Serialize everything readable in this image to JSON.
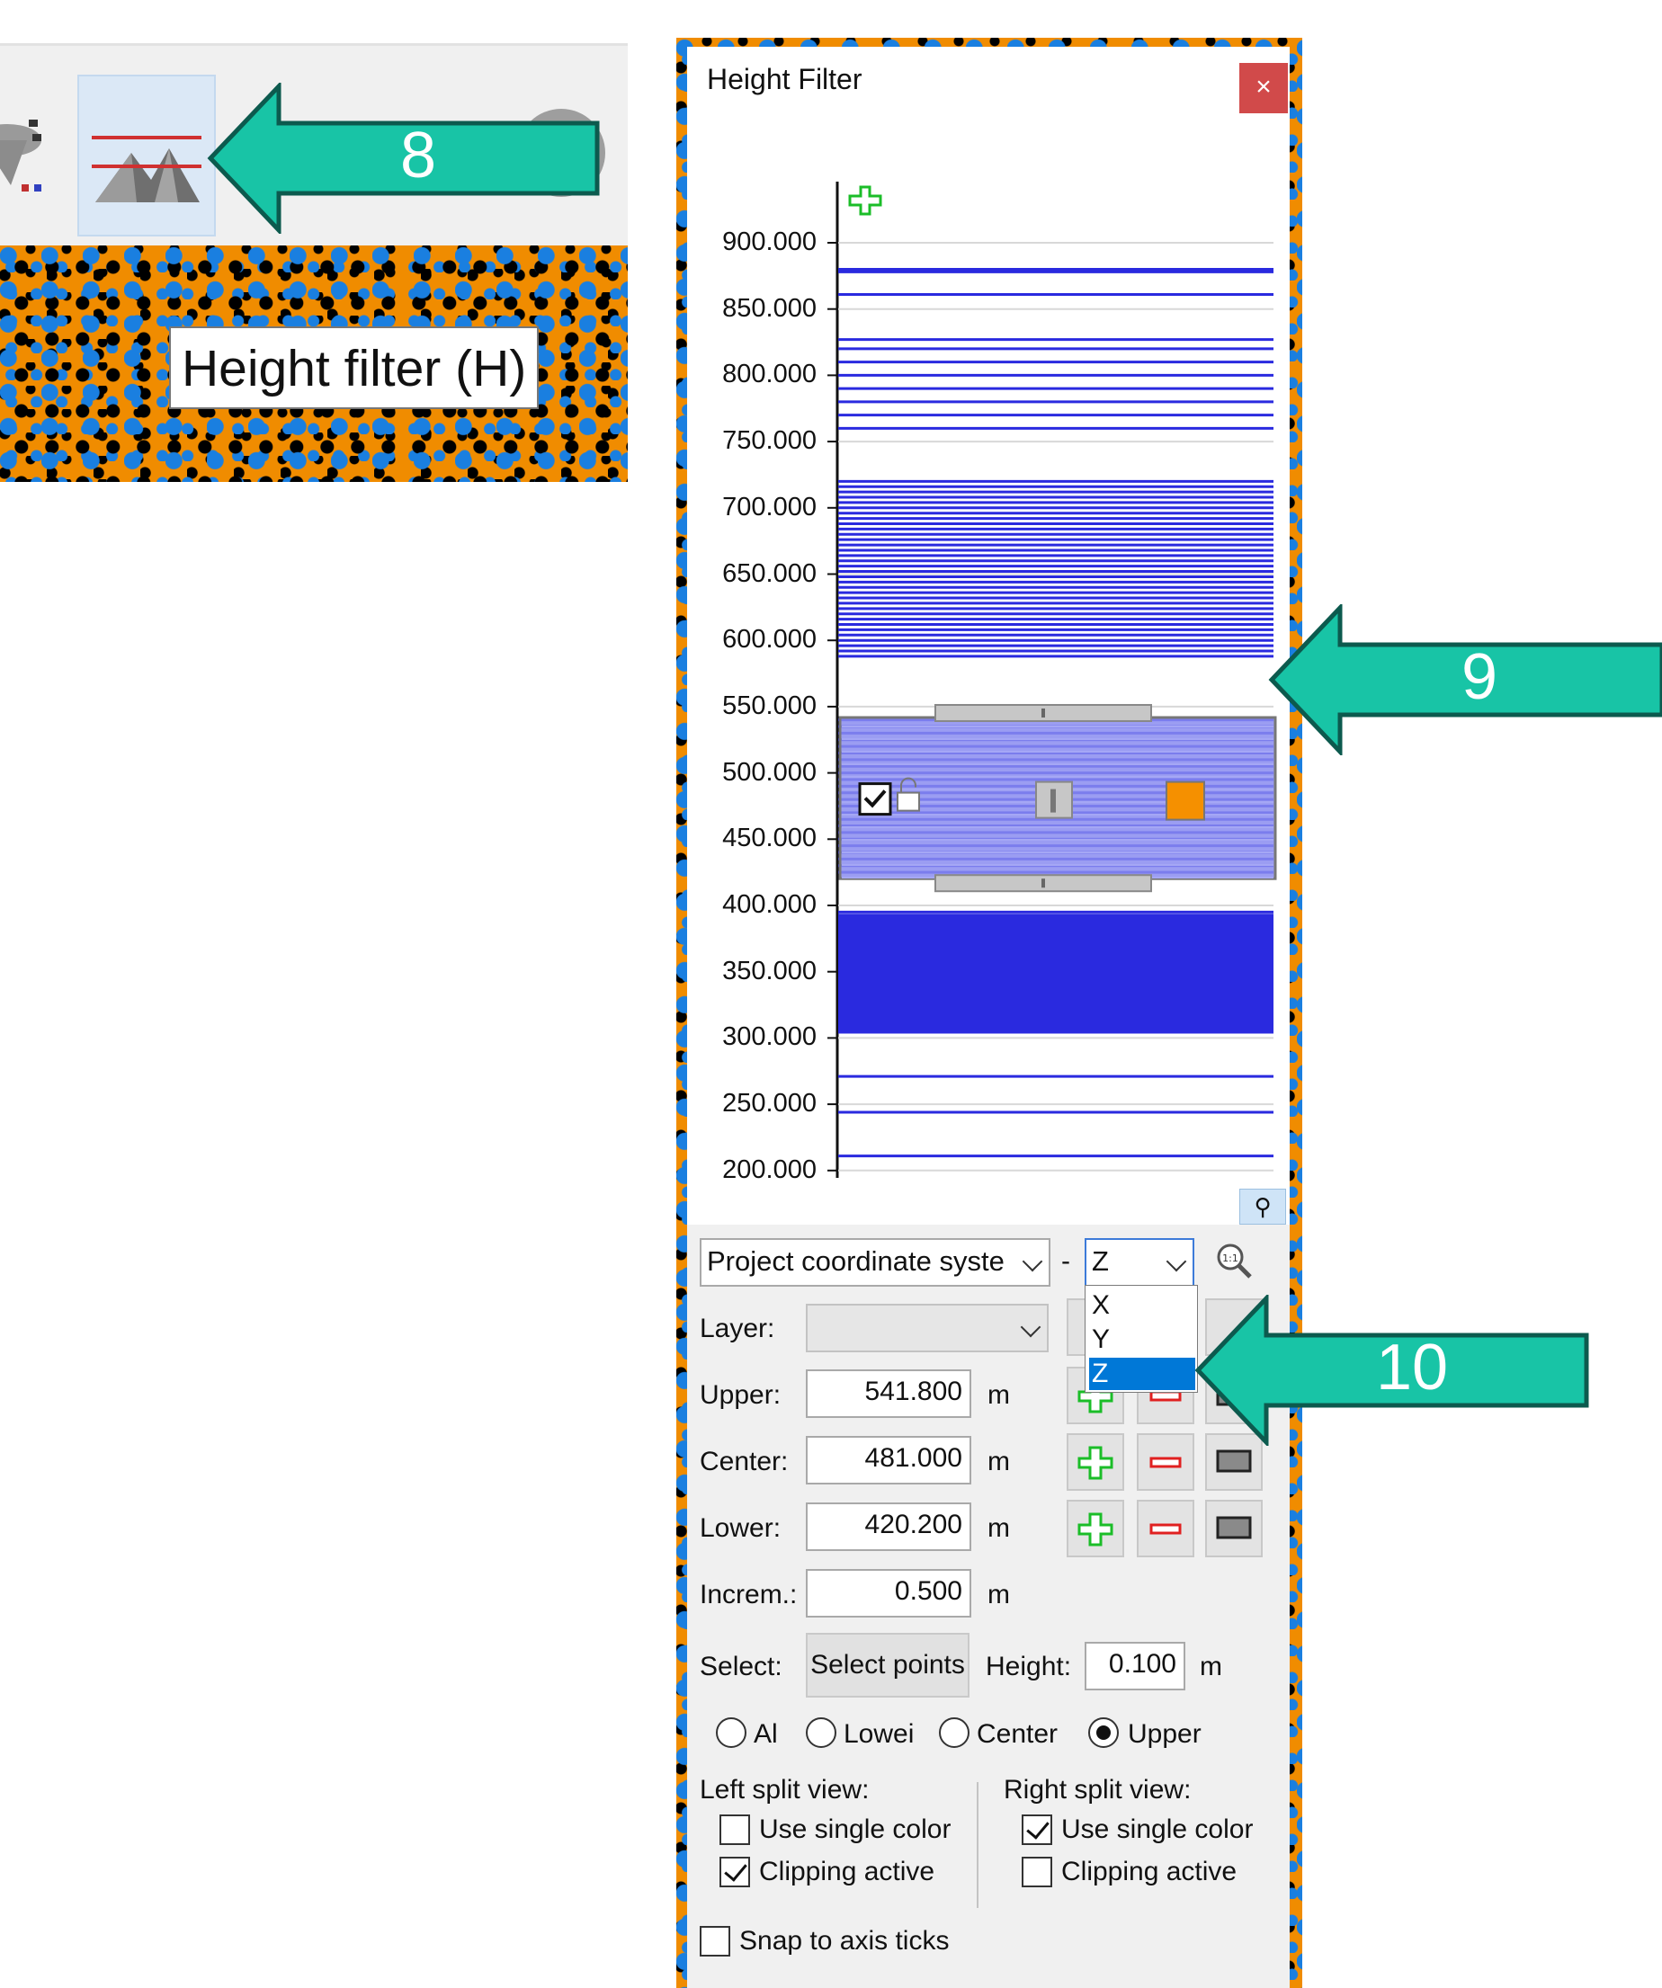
{
  "tooltip": {
    "text": "Height filter (H)"
  },
  "callouts": {
    "n8": "8",
    "n9": "9",
    "n10": "10",
    "color": "#18c4a6"
  },
  "dialog": {
    "title": "Height Filter",
    "close_glyph": "×",
    "chart": {
      "y_ticks": [
        "900.000",
        "850.000",
        "800.000",
        "750.000",
        "700.000",
        "650.000",
        "600.000",
        "550.000",
        "500.000",
        "450.000",
        "400.000",
        "350.000",
        "300.000",
        "250.000",
        "200.000"
      ],
      "y_tick_values": [
        900,
        850,
        800,
        750,
        700,
        650,
        600,
        550,
        500,
        450,
        400,
        350,
        300,
        250,
        200
      ],
      "band_upper": 541.8,
      "band_lower": 420.2,
      "band_color": "#f59000",
      "line_color": "#2a2adf"
    },
    "coord_system": "Project coordinate syste",
    "axis_sep": "-",
    "axis_value": "Z",
    "axis_options": [
      "X",
      "Y",
      "Z"
    ],
    "layer_label": "Layer:",
    "upper_label": "Upper:",
    "upper_value": "541.800",
    "center_label": "Center:",
    "center_value": "481.000",
    "lower_label": "Lower:",
    "lower_value": "420.200",
    "increm_label": "Increm.:",
    "increm_value": "0.500",
    "unit": "m",
    "select_label": "Select:",
    "select_button": "Select points",
    "height_label": "Height:",
    "height_value": "0.100",
    "radio_all": "Al",
    "radio_lower": "Lowei",
    "radio_center": "Center",
    "radio_upper": "Upper",
    "left_split": "Left split view:",
    "right_split": "Right split view:",
    "use_single_color": "Use single color",
    "clipping_active": "Clipping active",
    "snap": "Snap to axis ticks"
  }
}
